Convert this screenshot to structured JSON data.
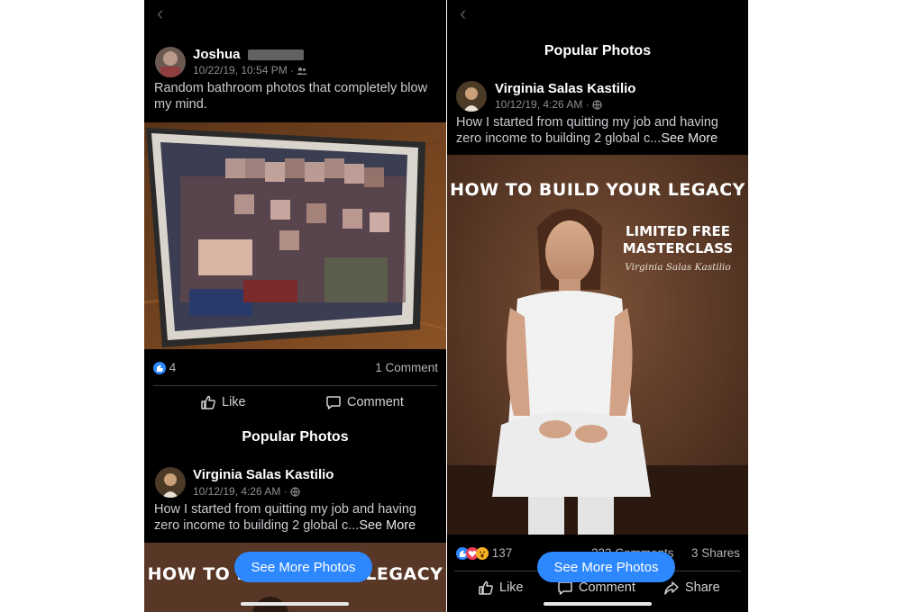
{
  "left": {
    "post": {
      "author": "Joshua",
      "timestamp": "10/22/19, 10:54 PM ·",
      "privacy_icon": "friends-icon",
      "caption": "Random bathroom photos that completely blow my mind.",
      "reactions_count": "4",
      "comments": "1 Comment",
      "like_label": "Like",
      "comment_label": "Comment"
    },
    "section_title": "Popular Photos",
    "popular": {
      "author": "Virginia Salas Kastilio",
      "timestamp": "10/12/19, 4:26 AM ·",
      "privacy_icon": "globe-icon",
      "caption": "How I started from quitting my job and having zero income to building 2 global c...",
      "see_more": "See More",
      "poster_headline": "HOW TO BUILD YOUR LEGACY"
    },
    "see_more_photos": "See More Photos"
  },
  "right": {
    "section_title": "Popular Photos",
    "post": {
      "author": "Virginia Salas Kastilio",
      "timestamp": "10/12/19, 4:26 AM ·",
      "privacy_icon": "globe-icon",
      "caption": "How I started from quitting my job and having zero income to building 2 global c...",
      "see_more": "See More",
      "poster_headline": "HOW TO BUILD YOUR LEGACY",
      "poster_sub1": "LIMITED FREE",
      "poster_sub2": "MASTERCLASS",
      "poster_name": "Virginia Salas Kastilio",
      "reactions_count": "137",
      "comments": "223 Comments",
      "shares": "3 Shares",
      "like_label": "Like",
      "comment_label": "Comment",
      "share_label": "Share"
    },
    "see_more_photos": "See More Photos"
  },
  "colors": {
    "background": "#000000",
    "accent": "#2d88ff",
    "text_primary": "#ffffff",
    "text_secondary": "#8a8d91"
  }
}
